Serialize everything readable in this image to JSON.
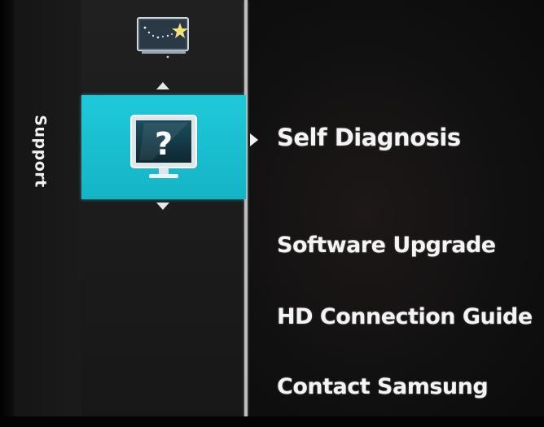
{
  "category": {
    "label": "Support"
  },
  "icons": {
    "previous_category": "picture-icon",
    "selected_category": "support-question-icon",
    "scroll_up": "arrow-up-icon",
    "scroll_down": "arrow-down-icon",
    "menu_pointer": "pointer-right-icon"
  },
  "menu": {
    "items": [
      {
        "label": "Self Diagnosis",
        "selected": true
      },
      {
        "label": "Software Upgrade",
        "selected": false
      },
      {
        "label": "HD Connection Guide",
        "selected": false
      },
      {
        "label": "Contact Samsung",
        "selected": false
      }
    ]
  },
  "colors": {
    "highlight": "#1fc9d9",
    "text": "#f4f4f4",
    "background": "#0a0a0a"
  },
  "selected_icon_glyph": "?"
}
